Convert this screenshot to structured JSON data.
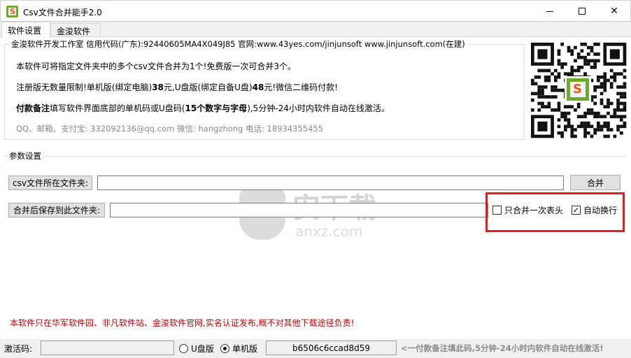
{
  "window": {
    "title": "Csv文件合并能手2.0",
    "icon": "si-logo-icon",
    "controls": {
      "minimize": "minimize-icon",
      "maximize": "maximize-icon",
      "close": "✕"
    }
  },
  "tabs": [
    {
      "label": "软件设置",
      "active": true
    },
    {
      "label": "金浚软件",
      "active": false
    }
  ],
  "info": {
    "group_title": "金浚软件开发工作室 信用代码(广东):92440605MA4X049J85 官网:www.43yes.com/jinjunsoft  www.jinjunsoft.com(在建)",
    "line1": "本软件可将指定文件夹中的多个csv文件合并为1个!免费版一次可合并3个。",
    "line2_pre": "注册版无数量限制!单机版(绑定电脑)",
    "line2_price1": "38",
    "line2_mid": "元,U盘版(绑定自备U盘)",
    "line2_price2": "48",
    "line2_post": "元!微信二维码付款!",
    "line3_bold": "付款备注",
    "line3_mid": "填写软件界面底部的单机码或U盘码(",
    "line3_bold2": "15个数字与字母",
    "line3_post": "),5分钟-24小时内软件自动在线激活。",
    "line4": "QQ、邮箱、支付宝: 332092136@qq.com   微信: hangzhong   电话: 18934355455"
  },
  "params": {
    "group_title": "参数设置",
    "folder_label": "csv文件所在文件夹:",
    "folder_value": "",
    "save_label": "合并后保存到此文件夹:",
    "save_value": "",
    "merge_button": "合并",
    "checkbox_header_once": {
      "label": "只合并一次表头",
      "checked": false
    },
    "checkbox_auto_wrap": {
      "label": "自动换行",
      "checked": true
    }
  },
  "watermark": {
    "text": "安下载",
    "sub": "anxz.com"
  },
  "notice": "本软件只在华军软件园、非凡软件站、金浚软件官网,实名认证发布,概不对其他下载途径负责!",
  "bottom": {
    "activation_label": "激活码:",
    "activation_value": "",
    "radio_u": {
      "label": "U盘版",
      "selected": false
    },
    "radio_pc": {
      "label": "单机版",
      "selected": true
    },
    "machine_code": "b6506c6ccad8d59",
    "hint": "<一付款备注填此码,5分钟-24小时内软件自动在线激活!"
  },
  "colors": {
    "accent_green": "#6cab2c",
    "logo_orange": "#e8571a",
    "notice_red": "#c00000",
    "highlight_red": "#e02020"
  }
}
